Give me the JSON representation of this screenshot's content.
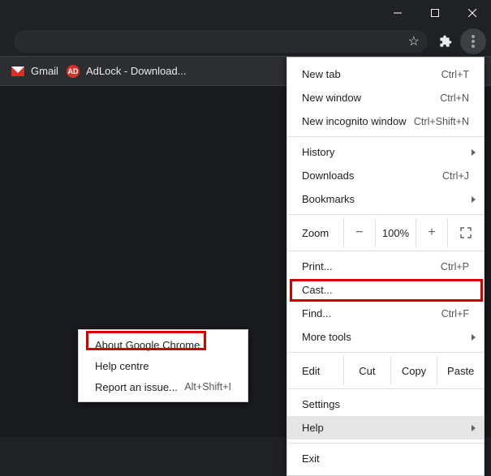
{
  "bookmarks": {
    "gmail": "Gmail",
    "adlock": "AdLock - Download...",
    "adlock_badge": "AD"
  },
  "menu": {
    "new_tab": {
      "label": "New tab",
      "shortcut": "Ctrl+T"
    },
    "new_window": {
      "label": "New window",
      "shortcut": "Ctrl+N"
    },
    "new_incognito": {
      "label": "New incognito window",
      "shortcut": "Ctrl+Shift+N"
    },
    "history": {
      "label": "History"
    },
    "downloads": {
      "label": "Downloads",
      "shortcut": "Ctrl+J"
    },
    "bookmarks": {
      "label": "Bookmarks"
    },
    "zoom": {
      "label": "Zoom",
      "minus": "−",
      "value": "100%",
      "plus": "+"
    },
    "print": {
      "label": "Print...",
      "shortcut": "Ctrl+P"
    },
    "cast": {
      "label": "Cast..."
    },
    "find": {
      "label": "Find...",
      "shortcut": "Ctrl+F"
    },
    "more_tools": {
      "label": "More tools"
    },
    "edit": {
      "label": "Edit",
      "cut": "Cut",
      "copy": "Copy",
      "paste": "Paste"
    },
    "settings": {
      "label": "Settings"
    },
    "help": {
      "label": "Help"
    },
    "exit": {
      "label": "Exit"
    }
  },
  "help_menu": {
    "about": "About Google Chrome",
    "help_centre": "Help centre",
    "report": {
      "label": "Report an issue...",
      "shortcut": "Alt+Shift+I"
    }
  }
}
